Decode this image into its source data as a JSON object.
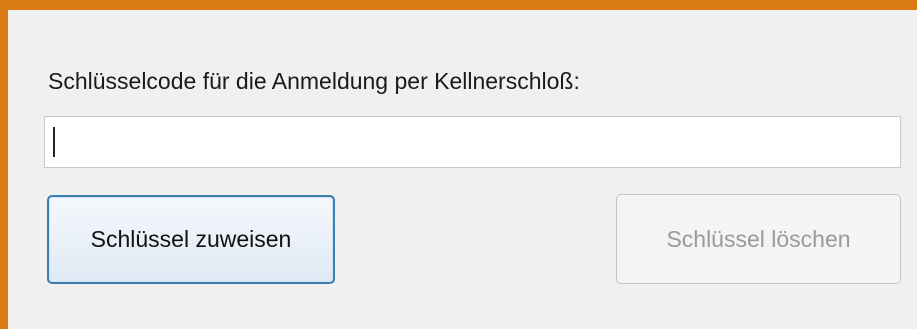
{
  "form": {
    "key_code_label": "Schlüsselcode für die Anmeldung per Kellnerschloß:",
    "key_code_value": "",
    "assign_button_label": "Schlüssel zuweisen",
    "delete_button_label": "Schlüssel löschen",
    "delete_button_enabled": false
  },
  "theme": {
    "frame_accent": "#d97a14",
    "background": "#f0f0f0",
    "primary_button_border": "#3c7fb1",
    "disabled_text": "#9a9a9a"
  }
}
